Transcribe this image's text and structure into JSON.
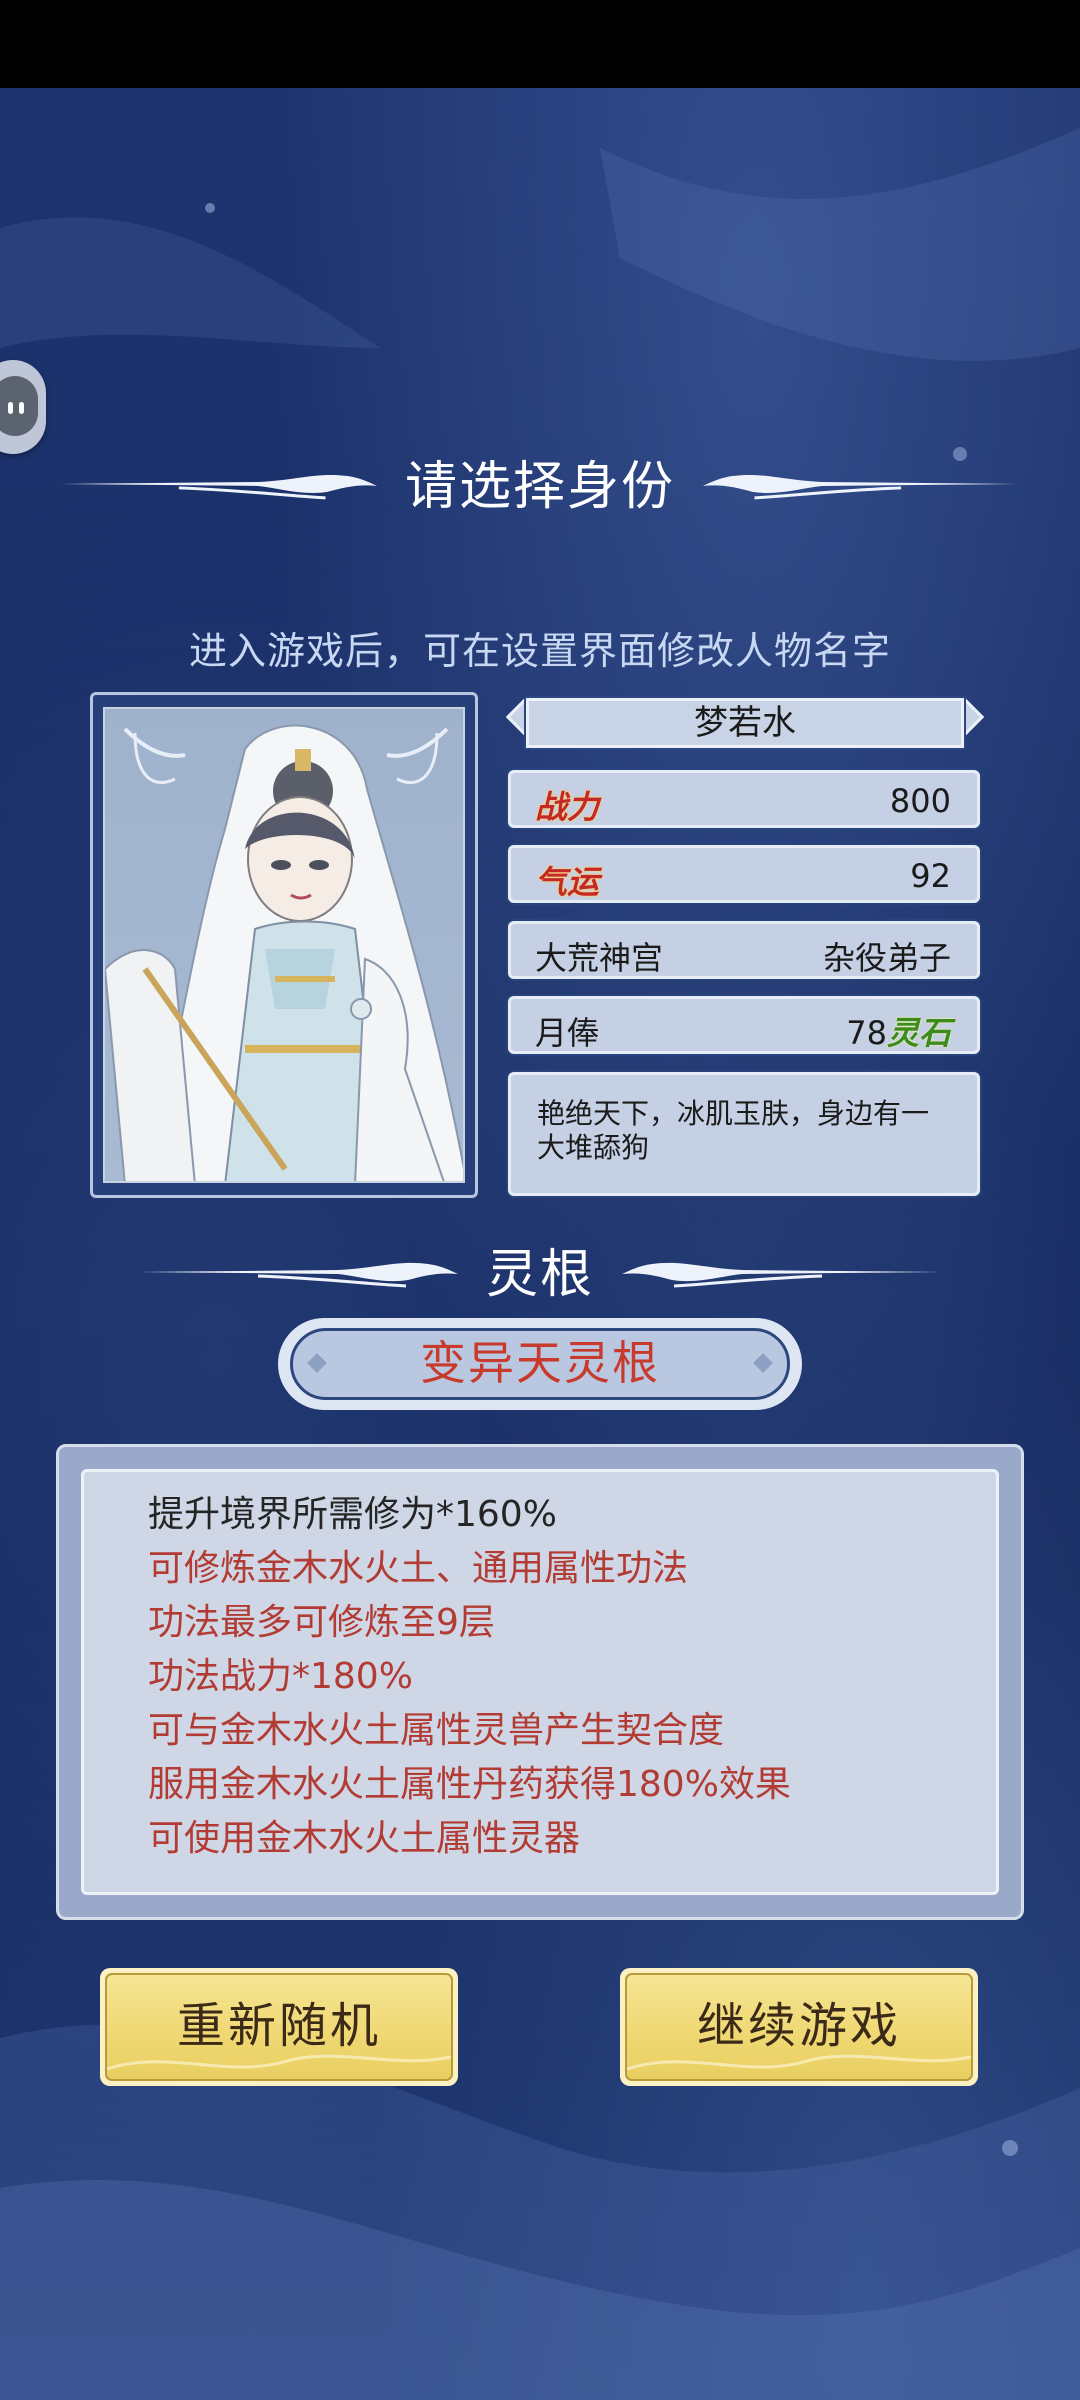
{
  "header": {
    "title": "请选择身份",
    "subtitle": "进入游戏后，可在设置界面修改人物名字"
  },
  "character": {
    "name": "梦若水",
    "stats": {
      "combat_label": "战力",
      "combat_value": "800",
      "luck_label": "气运",
      "luck_value": "92",
      "sect": "大荒神宫",
      "rank": "杂役弟子",
      "salary_label": "月俸",
      "salary_value": "78",
      "salary_unit": "灵石"
    },
    "description": "艳绝天下，冰肌玉肤，身边有一大堆舔狗"
  },
  "spirit_root": {
    "section_title": "灵根",
    "type": "变异天灵根",
    "traits": [
      "提升境界所需修为*160%",
      "可修炼金木水火土、通用属性功法",
      "功法最多可修炼至9层",
      "功法战力*180%",
      "可与金木水火土属性灵兽产生契合度",
      "服用金木水火土属性丹药获得180%效果",
      "可使用金木水火土属性灵器"
    ]
  },
  "buttons": {
    "reroll": "重新随机",
    "continue": "继续游戏"
  },
  "colors": {
    "background": "#1b3066",
    "panel": "#c6d0e4",
    "trait_red": "#b23b33",
    "button_gold": "#efd772"
  },
  "icons": {
    "floating_assistant": "chat-bubble-icon"
  }
}
